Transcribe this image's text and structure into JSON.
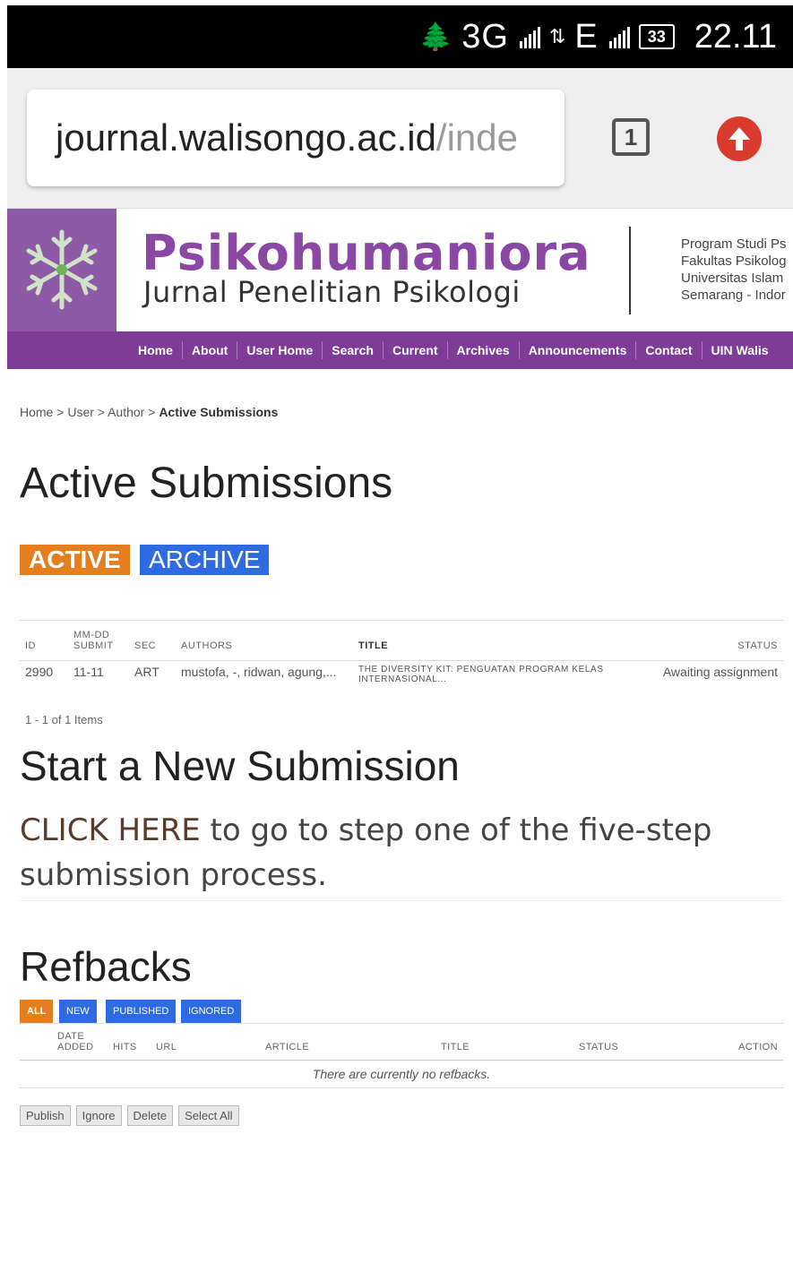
{
  "status_bar": {
    "network_1": "3G",
    "network_2": "E",
    "battery": "33",
    "time": "22.11"
  },
  "browser": {
    "url_main": "journal.walisongo.ac.id",
    "url_rest": "/inde",
    "tab_count": "1"
  },
  "header": {
    "title": "Psikohumaniora",
    "subtitle": "Jurnal Penelitian Psikologi",
    "institution_lines": [
      "Program Studi Ps",
      "Fakultas Psikolog",
      "Universitas Islam",
      "Semarang - Indor"
    ]
  },
  "nav": {
    "items": [
      "Home",
      "About",
      "User Home",
      "Search",
      "Current",
      "Archives",
      "Announcements",
      "Contact",
      "UIN Walis"
    ]
  },
  "breadcrumb": {
    "home": "Home",
    "user": "User",
    "author": "Author",
    "current": "Active Submissions",
    "sep": ">"
  },
  "page_title": "Active Submissions",
  "tabs": {
    "active": "ACTIVE",
    "archive": "ARCHIVE"
  },
  "submissions": {
    "headers": {
      "id": "ID",
      "date_top": "MM-DD",
      "date_bottom": "SUBMIT",
      "sec": "SEC",
      "authors": "AUTHORS",
      "title": "TITLE",
      "status": "STATUS"
    },
    "rows": [
      {
        "id": "2990",
        "date": "11-11",
        "sec": "ART",
        "authors": "mustofa, -, ridwan, agung,...",
        "title": "THE DIVERSITY KIT: PENGUATAN PROGRAM KELAS INTERNASIONAL...",
        "status": "Awaiting assignment"
      }
    ],
    "count": "1 - 1 of 1 Items"
  },
  "new_submission": {
    "heading": "Start a New Submission",
    "link": "CLICK HERE",
    "text": " to go to step one of the five-step submission process."
  },
  "refbacks": {
    "heading": "Refbacks",
    "filters": [
      "ALL",
      "NEW",
      "PUBLISHED",
      "IGNORED"
    ],
    "headers": {
      "date_top": "DATE",
      "date_bottom": "ADDED",
      "hits": "HITS",
      "url": "URL",
      "article": "ARTICLE",
      "title": "TITLE",
      "status": "STATUS",
      "action": "ACTION"
    },
    "empty": "There are currently no refbacks."
  },
  "buttons": {
    "publish": "Publish",
    "ignore": "Ignore",
    "delete": "Delete",
    "select_all": "Select All"
  },
  "colors": {
    "brand_purple": "#8a47a3",
    "nav_purple": "#7d3d96",
    "active_orange": "#e57e1e",
    "archive_blue": "#2e6be0",
    "upload_red": "#d93b2f"
  }
}
